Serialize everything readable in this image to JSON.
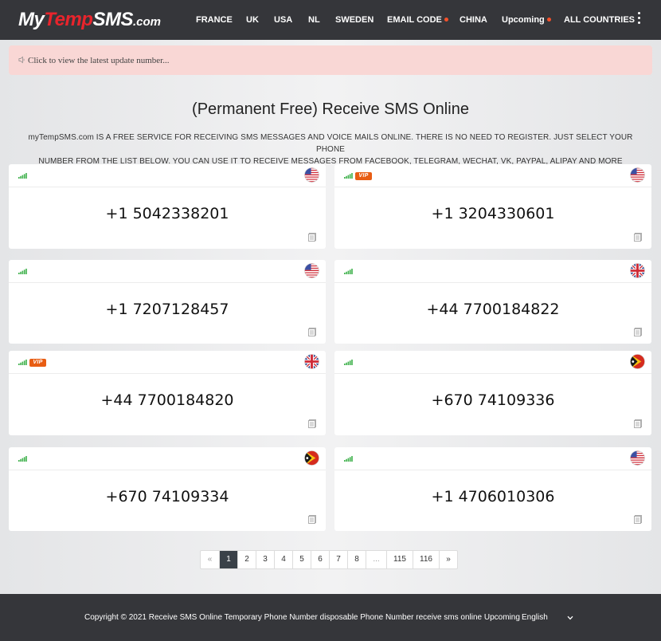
{
  "brand": {
    "part1": "My",
    "part2": "Temp",
    "part3": "SMS",
    "part4": ".com",
    "colors": {
      "white": "#ffffff",
      "red": "#e8242c"
    }
  },
  "nav": {
    "items": [
      {
        "label": "FRANCE",
        "dot": false
      },
      {
        "label": "UK",
        "dot": false
      },
      {
        "label": "USA",
        "dot": false
      },
      {
        "label": "NL",
        "dot": false
      },
      {
        "label": "SWEDEN",
        "dot": false
      },
      {
        "label": "EMAIL CODE",
        "dot": true
      },
      {
        "label": "CHINA",
        "dot": false
      },
      {
        "label": "Upcoming",
        "dot": true
      },
      {
        "label": "ALL COUNTRIES",
        "dot": false
      }
    ],
    "more_icon": "kebab-vertical-icon"
  },
  "notice": {
    "icon": "speaker-icon",
    "text": "Click to view the latest update number..."
  },
  "main": {
    "title": "(Permanent Free) Receive SMS Online",
    "intro_line1": "myTempSMS.com IS A FREE SERVICE FOR RECEIVING SMS MESSAGES AND VOICE MAILS ONLINE. THERE IS NO NEED TO REGISTER. JUST SELECT YOUR PHONE",
    "intro_line2": "NUMBER FROM THE LIST BELOW. YOU CAN USE IT TO RECEIVE MESSAGES FROM FACEBOOK, TELEGRAM, WECHAT, VK, PAYPAL, ALIPAY AND MORE"
  },
  "numbers": [
    {
      "phone": "+1 5042338201",
      "country": "us",
      "vip": false
    },
    {
      "phone": "+1 3204330601",
      "country": "us",
      "vip": true
    },
    {
      "phone": "+1 7207128457",
      "country": "us",
      "vip": false
    },
    {
      "phone": "+44 7700184822",
      "country": "uk",
      "vip": false
    },
    {
      "phone": "+44 7700184820",
      "country": "uk",
      "vip": true
    },
    {
      "phone": "+670 74109336",
      "country": "tl",
      "vip": false
    },
    {
      "phone": "+670 74109334",
      "country": "tl",
      "vip": false
    },
    {
      "phone": "+1 4706010306",
      "country": "us",
      "vip": false
    }
  ],
  "card_ui": {
    "vip_label": "VIP",
    "signal_icon": "signal-bars-icon",
    "doc_icon": "document-icon",
    "signal_color": "#3db04a"
  },
  "pagination": {
    "prev": "«",
    "pages": [
      "1",
      "2",
      "3",
      "4",
      "5",
      "6",
      "7",
      "8",
      "...",
      "115",
      "116"
    ],
    "active": "1",
    "next": "»"
  },
  "footer": {
    "text": "Copyright © 2021 Receive SMS Online Temporary Phone Number disposable Phone Number receive sms online Upcoming",
    "language": "English"
  }
}
